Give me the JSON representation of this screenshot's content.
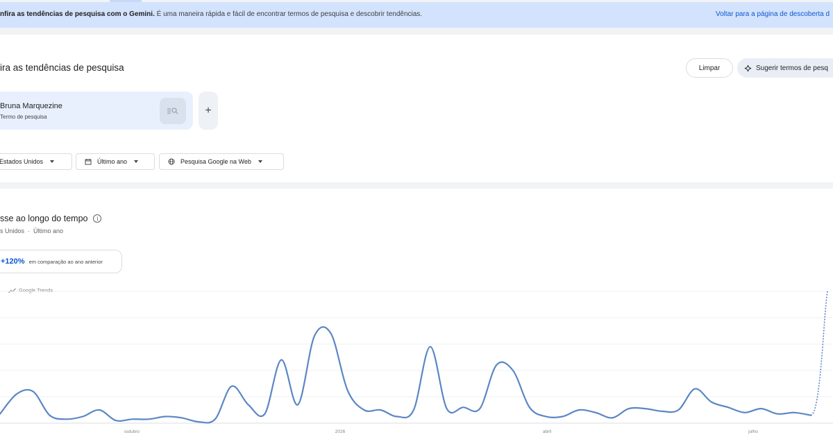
{
  "banner": {
    "text_bold": "nfira as tendências de pesquisa com o Gemini.",
    "text_rest": " É uma maneira rápida e fácil de encontrar termos de pesquisa e descobrir tendências.",
    "link": "Voltar para a página de descoberta d"
  },
  "explore": {
    "title": "ira as tendências de pesquisa",
    "clear_label": "Limpar",
    "suggest_label": "Sugerir termos de pesq",
    "term": {
      "name": "Bruna Marquezine",
      "type": "Termo de pesquisa"
    },
    "add_label": "+",
    "filters": {
      "region": "Estados Unidos",
      "time": "Último ano",
      "search_type": "Pesquisa Google na Web"
    }
  },
  "interest": {
    "title": "sse ao longo do tempo",
    "info": "i",
    "region": "s Unidos",
    "separator": "·",
    "time": "Último ano",
    "change_value": "+120%",
    "change_label": "em comparação ao ano anterior",
    "watermark": "Google Trends"
  },
  "colors": {
    "banner_bg": "#d3e3fd",
    "accent": "#0b57d0",
    "line": "#5b86c5",
    "chip_bg": "#e8f0fe"
  },
  "chart_data": {
    "type": "line",
    "title": "",
    "xlabel": "",
    "ylabel": "",
    "x_ticks": [
      "outubro",
      "2026",
      "abril",
      "julho"
    ],
    "ylim": [
      0,
      100
    ],
    "grid": true,
    "series": [
      {
        "values": [
          7,
          22,
          24,
          6,
          3,
          5,
          10,
          2,
          3,
          3,
          5,
          4,
          1,
          3,
          28,
          14,
          7,
          48,
          14,
          66,
          68,
          25,
          10,
          10,
          5,
          10,
          58,
          11,
          12,
          11,
          44,
          40,
          12,
          5,
          5,
          10,
          8,
          4,
          11,
          11,
          9,
          10,
          26,
          16,
          12,
          8,
          11,
          7,
          8,
          6
        ]
      },
      {
        "style": "dashed",
        "values": [
          6,
          100
        ]
      }
    ]
  }
}
